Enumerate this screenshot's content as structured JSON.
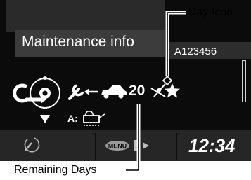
{
  "screen": {
    "title": "Maintenance info",
    "code": "A123456",
    "remaining_days": "20",
    "fuel_code": "A:",
    "menu_label": "MENU",
    "clock": "12:34"
  },
  "callouts": {
    "day_icon": "Day Icon",
    "remaining_days": "Remaining Days"
  },
  "icons": [
    "back-arrow-icon",
    "selector-knob-icon",
    "down-arrow-icon",
    "wrench-icon",
    "left-arrow-icon",
    "car-icon",
    "day-icon",
    "star-icon",
    "oil-can-icon",
    "phone-call-icon",
    "menu-button-icon",
    "source-arrow-icon"
  ],
  "colors": {
    "screen_background": "#0b0b0b",
    "bar_background": "#3c3c3c",
    "text": "#ffffff",
    "callout_text": "#000000"
  }
}
